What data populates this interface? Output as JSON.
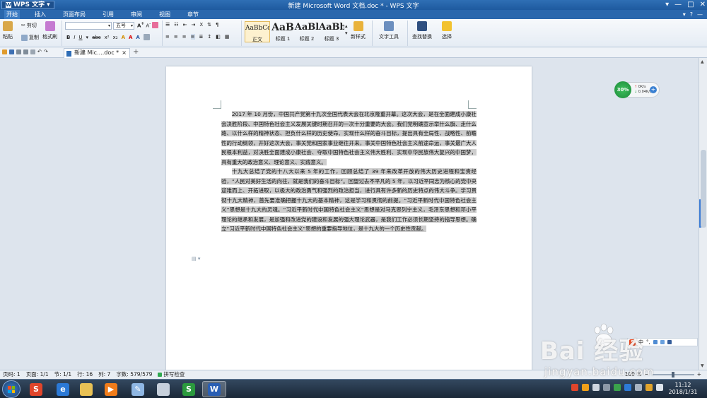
{
  "titlebar": {
    "app_button": "WPS 文字",
    "title": "新建 Microsoft Word 文档.doc * - WPS 文字",
    "controls": [
      "▾",
      "—",
      "□",
      "✕"
    ]
  },
  "menubar": {
    "items": [
      "开始",
      "插入",
      "页面布局",
      "引用",
      "审阅",
      "视图",
      "章节"
    ],
    "active": "开始",
    "right": [
      "▾",
      "?",
      "—"
    ]
  },
  "ribbon": {
    "paste": "粘贴",
    "cut": "剪切",
    "copy": "复制",
    "format_painter": "格式刷",
    "font_name": "",
    "font_size": "五号",
    "styles": [
      {
        "sample": "AaBbCcDd",
        "label": "正文"
      },
      {
        "sample": "AaB",
        "label": "标题 1"
      },
      {
        "sample": "AaBl",
        "label": "标题 2"
      },
      {
        "sample": "AaBb",
        "label": "标题 3"
      }
    ],
    "new_style": "新样式",
    "text_tools": "文字工具",
    "find_replace": "查找替换",
    "select": "选择",
    "format_buttons": [
      "B",
      "I",
      "U",
      "A",
      "A",
      "A"
    ]
  },
  "tabbar": {
    "doc_tab": "新建 Mic....doc *",
    "close": "×",
    "add": "+"
  },
  "document": {
    "paragraphs": [
      "2017 年 10 月份，中国共产党第十九次全国代表大会在北京隆重开幕。这次大会，是在全面建成小康社会决胜阶段、中国特色社会主义发展关键时期召开的一次十分重要的大会。我们党明确宣示举什么旗、走什么路、以什么样的精神状态、担负什么样的历史使命、实现什么样的奋斗目标，提出具有全局性、战略性、前瞻性的行动纲领，开好这次大会，事关党和国家事业继往开来，事关中国特色社会主义前途命运，事关最广大人民根本利益，对决胜全面建成小康社会、夺取中国特色社会主义伟大胜利、实现中华民族伟大复兴的中国梦，具有重大的政治意义、理论意义、实践意义。",
      "十九大总结了党的十八大以来 5 年的工作，回顾总结了 39 年来改革开放的伟大历史进程和宝贵经验，“人民对美好生活的向往，就是我们的奋斗目标”。回望过去不平凡的 5 年，以习近平同志为核心的党中央迎难而上、开拓进取，以极大的政治勇气和强烈的政治担当，进行具有许多新的历史特点的伟大斗争。学习贯彻十九大精神，首先要准确把握十九大的基本精神，这是学习和贯彻的前提。“习近平新时代中国特色社会主义”思想是十九大的灵魂。“习近平新时代中国特色社会主义”思想是对马克思列宁主义，毛泽东思想和邓小平理论的继承和发展，是加强和改进党的建设和发展的强大理论武器，是我们工作必须长期坚持的指导思想。确立“习近平新时代中国特色社会主义”思想的重要指导地位，是十九大的一个历史性贡献。"
    ]
  },
  "network_widget": {
    "percent": "30%",
    "up": "0K/s",
    "down": "0.04K/s",
    "plus": "+"
  },
  "statusbar": {
    "page": "页码: 1",
    "pages": "页面: 1/1",
    "section": "节: 1/1",
    "row": "行: 16",
    "col": "列: 7",
    "word_count": "字数: 579/579",
    "spell_check": "拼写检查",
    "zoom": "100 %"
  },
  "watermark": {
    "brand": "Bai  经验",
    "url": "jingyan.baidu.com"
  },
  "taskbar": {
    "apps": [
      "sogou",
      "ie",
      "explorer",
      "media-player",
      "paint",
      "clipboard",
      "wps-spreadsheet",
      "wps-writer"
    ],
    "clock_time": "11:12",
    "clock_date": "2018/1/31"
  },
  "colors": {
    "title_blue": "#2f6fb5",
    "menu_blue": "#2a67ad",
    "selection_gray": "#cdcdcd",
    "taskbar": "#1b2838"
  }
}
